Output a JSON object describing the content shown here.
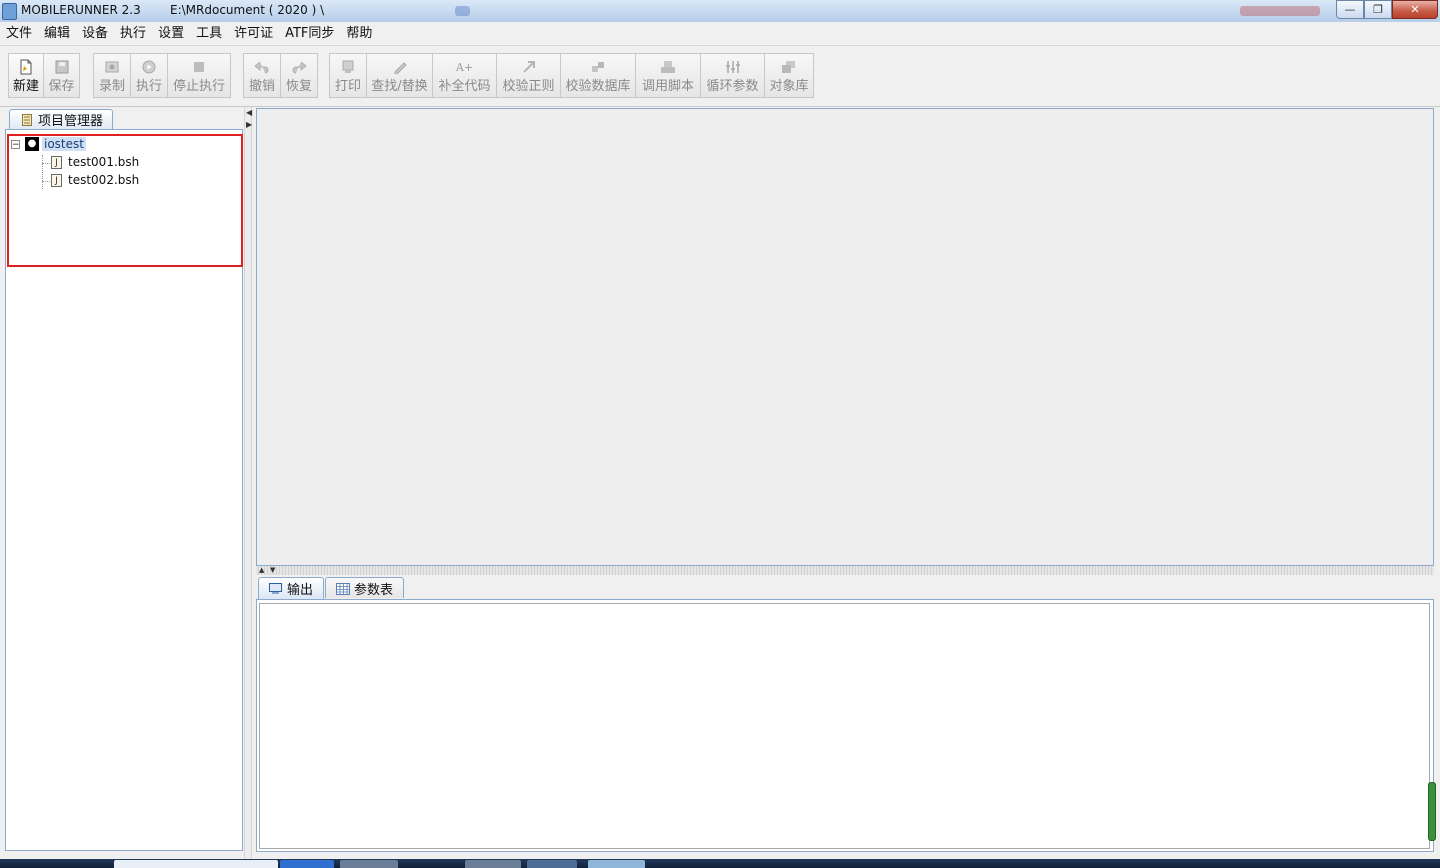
{
  "window": {
    "app_name": "MOBILERUNNER 2.3",
    "path": "E:\\MRdocument ( 2020 ) \\",
    "buttons": {
      "minimize": "—",
      "maximize": "❐",
      "close": "✕"
    }
  },
  "menu": [
    "文件",
    "编辑",
    "设备",
    "执行",
    "设置",
    "工具",
    "许可证",
    "ATF同步",
    "帮助"
  ],
  "toolbar": {
    "groups": [
      [
        {
          "label": "新建",
          "icon": "new-file-icon",
          "enabled": true
        },
        {
          "label": "保存",
          "icon": "save-icon",
          "enabled": false
        }
      ],
      [
        {
          "label": "录制",
          "icon": "record-icon",
          "enabled": false
        },
        {
          "label": "执行",
          "icon": "play-icon",
          "enabled": false
        },
        {
          "label": "停止执行",
          "icon": "stop-icon",
          "enabled": false
        }
      ],
      [
        {
          "label": "撤销",
          "icon": "undo-icon",
          "enabled": false
        },
        {
          "label": "恢复",
          "icon": "redo-icon",
          "enabled": false
        }
      ],
      [
        {
          "label": "打印",
          "icon": "print-icon",
          "enabled": false
        },
        {
          "label": "查找/替换",
          "icon": "find-replace-icon",
          "enabled": false
        },
        {
          "label": "补全代码",
          "icon": "autocomplete-icon",
          "enabled": false
        },
        {
          "label": "校验正则",
          "icon": "regex-check-icon",
          "enabled": false
        },
        {
          "label": "校验数据库",
          "icon": "db-check-icon",
          "enabled": false
        },
        {
          "label": "调用脚本",
          "icon": "call-script-icon",
          "enabled": false
        },
        {
          "label": "循环参数",
          "icon": "loop-params-icon",
          "enabled": false
        },
        {
          "label": "对象库",
          "icon": "object-library-icon",
          "enabled": false
        }
      ]
    ]
  },
  "project_panel": {
    "tab_label": "项目管理器",
    "tree": {
      "root": {
        "label": "iostest",
        "expander": "−",
        "icon": "apple-project-icon"
      },
      "files": [
        {
          "label": "test001.bsh",
          "icon": "java-file-icon"
        },
        {
          "label": "test002.bsh",
          "icon": "java-file-icon"
        }
      ]
    }
  },
  "bottom_panel": {
    "tabs": [
      {
        "label": "输出",
        "icon": "console-icon",
        "active": true
      },
      {
        "label": "参数表",
        "icon": "table-icon",
        "active": false
      }
    ]
  }
}
